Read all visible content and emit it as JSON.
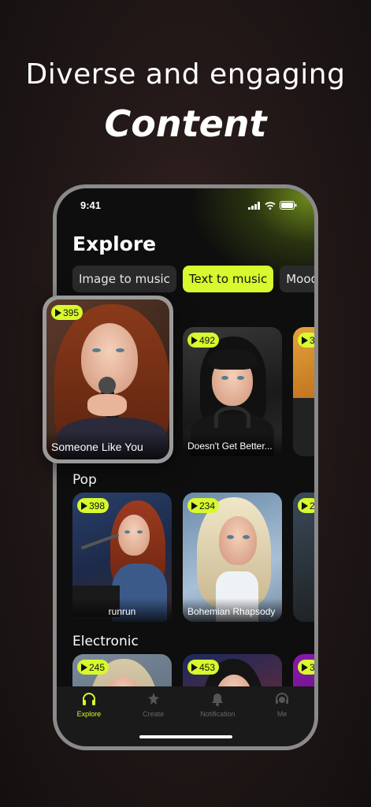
{
  "promo": {
    "line1": "Diverse and engaging",
    "line2": "Content"
  },
  "status": {
    "time": "9:41"
  },
  "page": {
    "title": "Explore"
  },
  "tabs": [
    "Image to music",
    "Text to music",
    "Mood"
  ],
  "active_tab": "Text to music",
  "featured": {
    "plays": "395",
    "title": "Someone Like You"
  },
  "top_row": [
    {
      "plays": "492",
      "title": "Doesn't Get Better..."
    },
    {
      "plays": "3",
      "title": ""
    }
  ],
  "sections": [
    {
      "name": "Pop",
      "cards": [
        {
          "plays": "398",
          "title": "runrun"
        },
        {
          "plays": "234",
          "title": "Bohemian Rhapsody"
        },
        {
          "plays": "2",
          "title": ""
        }
      ]
    },
    {
      "name": "Electronic",
      "cards": [
        {
          "plays": "245",
          "title": ""
        },
        {
          "plays": "453",
          "title": ""
        },
        {
          "plays": "3",
          "title": ""
        }
      ]
    }
  ],
  "tabbar": [
    {
      "label": "Explore",
      "icon": "headphones-icon"
    },
    {
      "label": "Create",
      "icon": "star-wand-icon"
    },
    {
      "label": "Notification",
      "icon": "bell-icon"
    },
    {
      "label": "Me",
      "icon": "user-headset-icon"
    }
  ],
  "colors": {
    "accent": "#d7f92d",
    "background": "#0e0e0e"
  }
}
